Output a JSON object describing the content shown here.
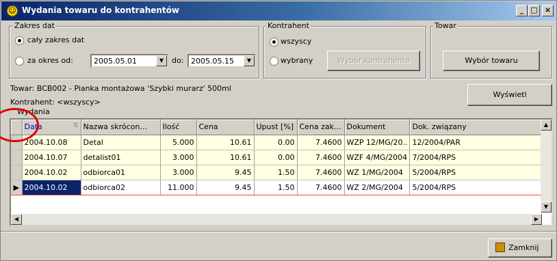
{
  "window": {
    "title": "Wydania towaru do kontrahentów",
    "controls": [
      "_",
      "□",
      "×"
    ]
  },
  "date_range": {
    "group_label": "Zakres dat",
    "option_all": "cały zakres dat",
    "option_period": "za okres od:",
    "from_value": "2005.05.01",
    "to_label": "do:",
    "to_value": "2005.05.15"
  },
  "contractor": {
    "group_label": "Kontrahent",
    "option_all": "wszyscy",
    "option_selected": "wybrany",
    "choose_button": "Wybór kontrahenta"
  },
  "product": {
    "group_label": "Towar",
    "choose_button": "Wybór towaru"
  },
  "info": {
    "product_line": "Towar: BCB002 - Pianka montażowa 'Szybki murarz' 500ml",
    "contractor_line": "Kontrahent: <wszyscy>"
  },
  "show_button": "Wyświetl",
  "issues": {
    "group_label": "Wydania",
    "columns": [
      "Data",
      "Nazwa skrócon...",
      "Ilość",
      "Cena",
      "Upust [%]",
      "Cena zak...",
      "Dokument",
      "Dok. związany"
    ],
    "rows": [
      [
        "2004.10.08",
        "Detal",
        "5.000",
        "10.61",
        "0.00",
        "7.4600",
        "WZP 12/MG/20..",
        "12/2004/PAR"
      ],
      [
        "2004.10.07",
        "detalist01",
        "3.000",
        "10.61",
        "0.00",
        "7.4600",
        "WZF 4/MG/2004",
        "7/2004/RPS"
      ],
      [
        "2004.10.02",
        "odbiorca01",
        "3.000",
        "9.45",
        "1.50",
        "7.4600",
        "WZ 1/MG/2004",
        "5/2004/RPS"
      ],
      [
        "2004.10.02",
        "odbiorca02",
        "11.000",
        "9.45",
        "1.50",
        "7.4600",
        "WZ 2/MG/2004",
        "5/2004/RPS"
      ]
    ]
  },
  "close_button": "Zamknij",
  "colors": {
    "titlebar": "#0a246a",
    "row_background": "#ffffe1",
    "selected_cell": "#0a246a",
    "annotation_circle": "#e00000"
  }
}
